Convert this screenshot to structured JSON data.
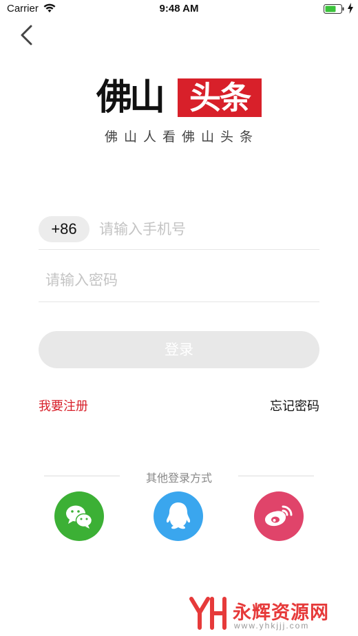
{
  "status_bar": {
    "carrier": "Carrier",
    "time": "9:48 AM",
    "icons": [
      "wifi-icon",
      "battery-icon",
      "charging-bolt-icon"
    ]
  },
  "nav": {
    "back_icon": "chevron-left-icon"
  },
  "brand": {
    "logo_black": "佛山",
    "logo_red": "头条",
    "tagline": "佛山人看佛山头条",
    "accent_color": "#d8202a"
  },
  "form": {
    "country_code": "+86",
    "phone_placeholder": "请输入手机号",
    "password_placeholder": "请输入密码",
    "login_label": "登录"
  },
  "links": {
    "register": "我要注册",
    "forgot_password": "忘记密码"
  },
  "other_login": {
    "label": "其他登录方式",
    "providers": [
      {
        "name": "wechat",
        "icon": "wechat-icon",
        "color": "#3cb035"
      },
      {
        "name": "qq",
        "icon": "qq-icon",
        "color": "#3aa6ee"
      },
      {
        "name": "weibo",
        "icon": "weibo-icon",
        "color": "#e0446a"
      }
    ]
  },
  "watermark": {
    "text": "永辉资源网",
    "url": "www.yhkjjj.com",
    "color": "#e63a3a"
  }
}
